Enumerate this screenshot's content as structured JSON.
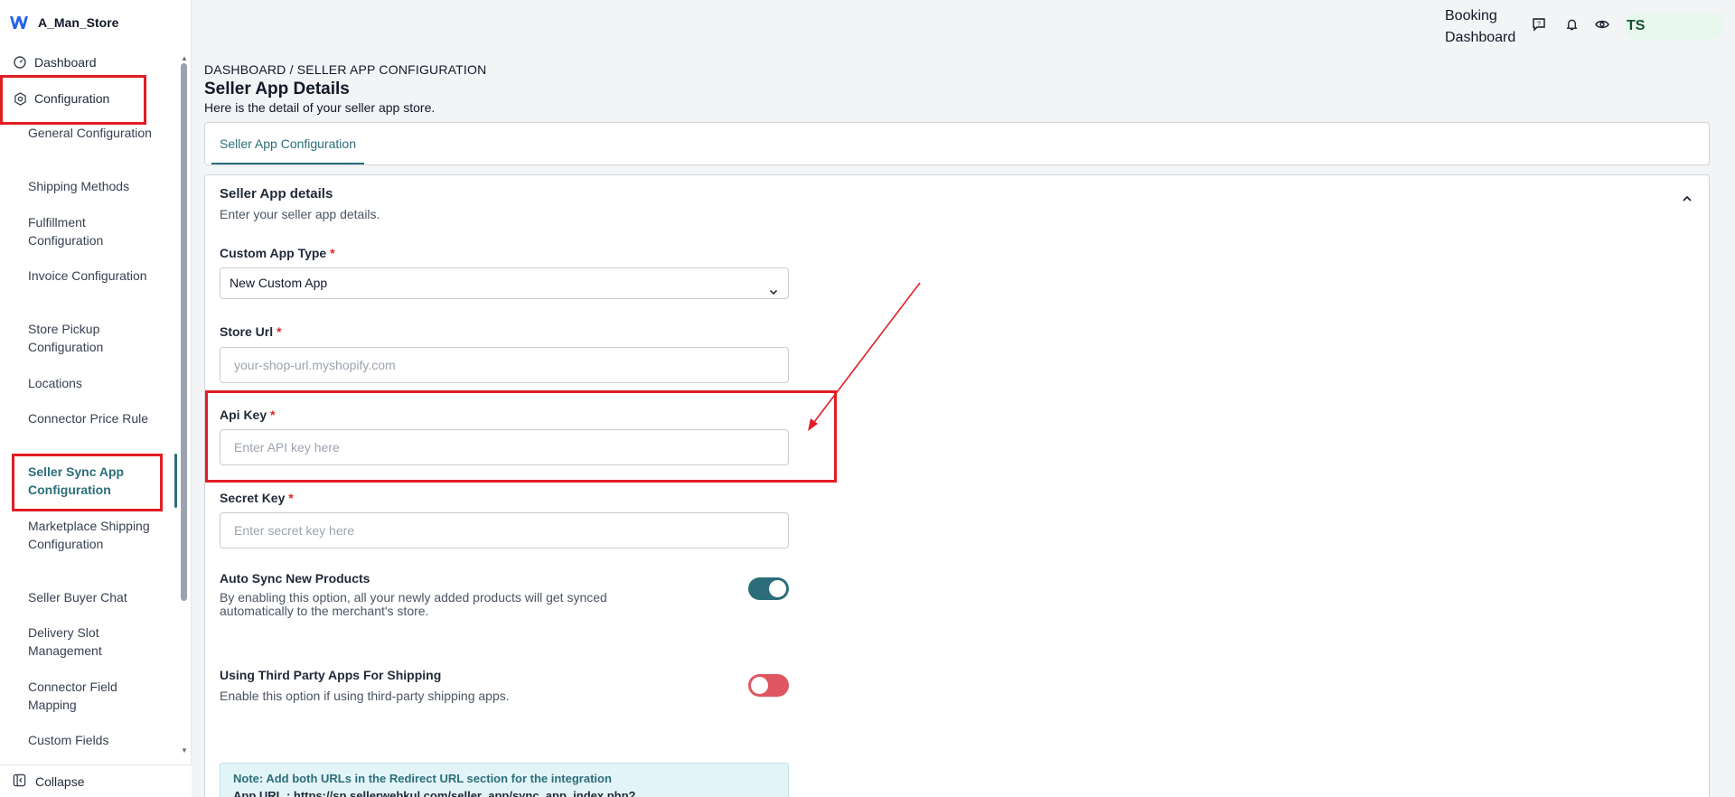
{
  "brand": {
    "name": "A_Man_Store"
  },
  "sidebar": {
    "dashboard": "Dashboard",
    "configuration": "Configuration",
    "items": [
      "General Configuration",
      "Shipping Methods",
      "Fulfillment Configuration",
      "Invoice Configuration",
      "Store Pickup Configuration",
      "Locations",
      "Connector Price Rule",
      "Seller Sync App Configuration",
      "Marketplace Shipping Configuration",
      "Seller Buyer Chat",
      "Delivery Slot Management",
      "Connector Field Mapping",
      "Custom Fields"
    ],
    "active_index": 7,
    "collapse": "Collapse"
  },
  "header": {
    "booking_line1": "Booking",
    "booking_line2": "Dashboard",
    "avatar": "TS"
  },
  "page": {
    "breadcrumb": "DASHBOARD / SELLER APP CONFIGURATION",
    "title": "Seller App Details",
    "subtitle": "Here is the detail of your seller app store.",
    "tab": "Seller App Configuration"
  },
  "section": {
    "title": "Seller App details",
    "subtitle": "Enter your seller app details."
  },
  "fields": {
    "custom_app_type": {
      "label": "Custom App Type",
      "value": "New Custom App"
    },
    "store_url": {
      "label": "Store Url",
      "placeholder": "your-shop-url.myshopify.com"
    },
    "api_key": {
      "label": "Api Key",
      "placeholder": "Enter API key here"
    },
    "secret_key": {
      "label": "Secret Key",
      "placeholder": "Enter secret key here"
    },
    "required_mark": "*"
  },
  "toggles": {
    "auto_sync": {
      "title": "Auto Sync New Products",
      "desc": "By enabling this option, all your newly added products will get synced automatically to the merchant's store.",
      "state": "on"
    },
    "third_party": {
      "title": "Using Third Party Apps For Shipping",
      "desc": "Enable this option if using third-party shipping apps.",
      "state": "off"
    }
  },
  "note": {
    "title": "Note: Add both URLs in the Redirect URL section for the integration",
    "url": "App URL : https://sp.sellerwebkul.com/seller_app/sync_app_index.php?"
  },
  "colors": {
    "accent": "#2b6e7a",
    "highlight": "#e11d24",
    "toggle_off": "#e05660"
  }
}
